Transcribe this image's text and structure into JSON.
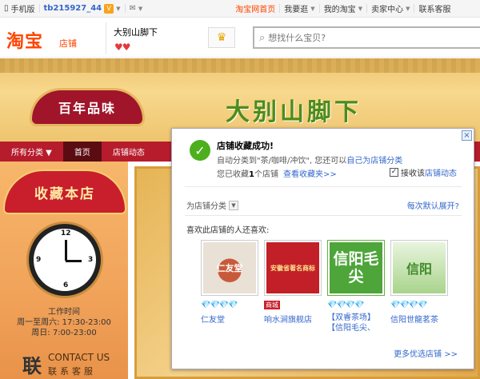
{
  "topbar": {
    "mobile": "手机版",
    "username": "tb215927_44",
    "vip": "V",
    "mail_icon": "✉",
    "taobao_home": "淘宝网首页",
    "buy": "我要逛",
    "my_taobao": "我的淘宝",
    "seller_center": "卖家中心",
    "contact_service": "联系客服"
  },
  "header": {
    "logo": "淘宝",
    "logo_sub": "店铺",
    "shop_name": "大别山脚下",
    "hearts": "♥♥",
    "search_placeholder": "想找什么宝贝?"
  },
  "banner": {
    "badge": "百年品味",
    "title": "大别山脚下"
  },
  "nav": {
    "items": [
      "所有分类 ▼",
      "首页",
      "店铺动态"
    ]
  },
  "left": {
    "collect": "收藏本店",
    "worktime_label": "工作时间",
    "worktime_weekday": "周一至周六: 17:30-23:00",
    "worktime_sunday": "周日: 7:00-23:00",
    "contact_en": "CONTACT US",
    "contact_cn": "联系客服",
    "contact_char": "联"
  },
  "popup": {
    "title": "店铺收藏成功!",
    "line1_pre": "自动分类到\"茶/咖啡/冲饮\", 您还可以",
    "line1_link": "自己为店铺分类",
    "line2_pre": "您已收藏",
    "line2_count": "1",
    "line2_post": "个店铺",
    "view_fav": "查看收藏夹>>",
    "receive_label": "接收该",
    "receive_link": "店铺动态",
    "classify": "为店铺分类",
    "expand": "每次默认展开?",
    "like_title": "喜欢此店铺的人还喜欢:",
    "shops": [
      {
        "thumb_text": "仁友堂",
        "gems": "💎💎💎💎",
        "mall": "",
        "name": "仁友堂"
      },
      {
        "thumb_text": "安徽省著名商标",
        "gems": "",
        "mall": "商城",
        "name": "响水涧旗舰店"
      },
      {
        "thumb_text": "信阳毛尖",
        "gems": "💎💎💎💎",
        "mall": "",
        "name": "【双睿茶场】【信阳毛尖、"
      },
      {
        "thumb_text": "信阳",
        "gems": "💎💎💎💎",
        "mall": "",
        "name": "信阳世龍茗茶"
      }
    ],
    "more": "更多优选店铺 >>",
    "close": "×"
  }
}
